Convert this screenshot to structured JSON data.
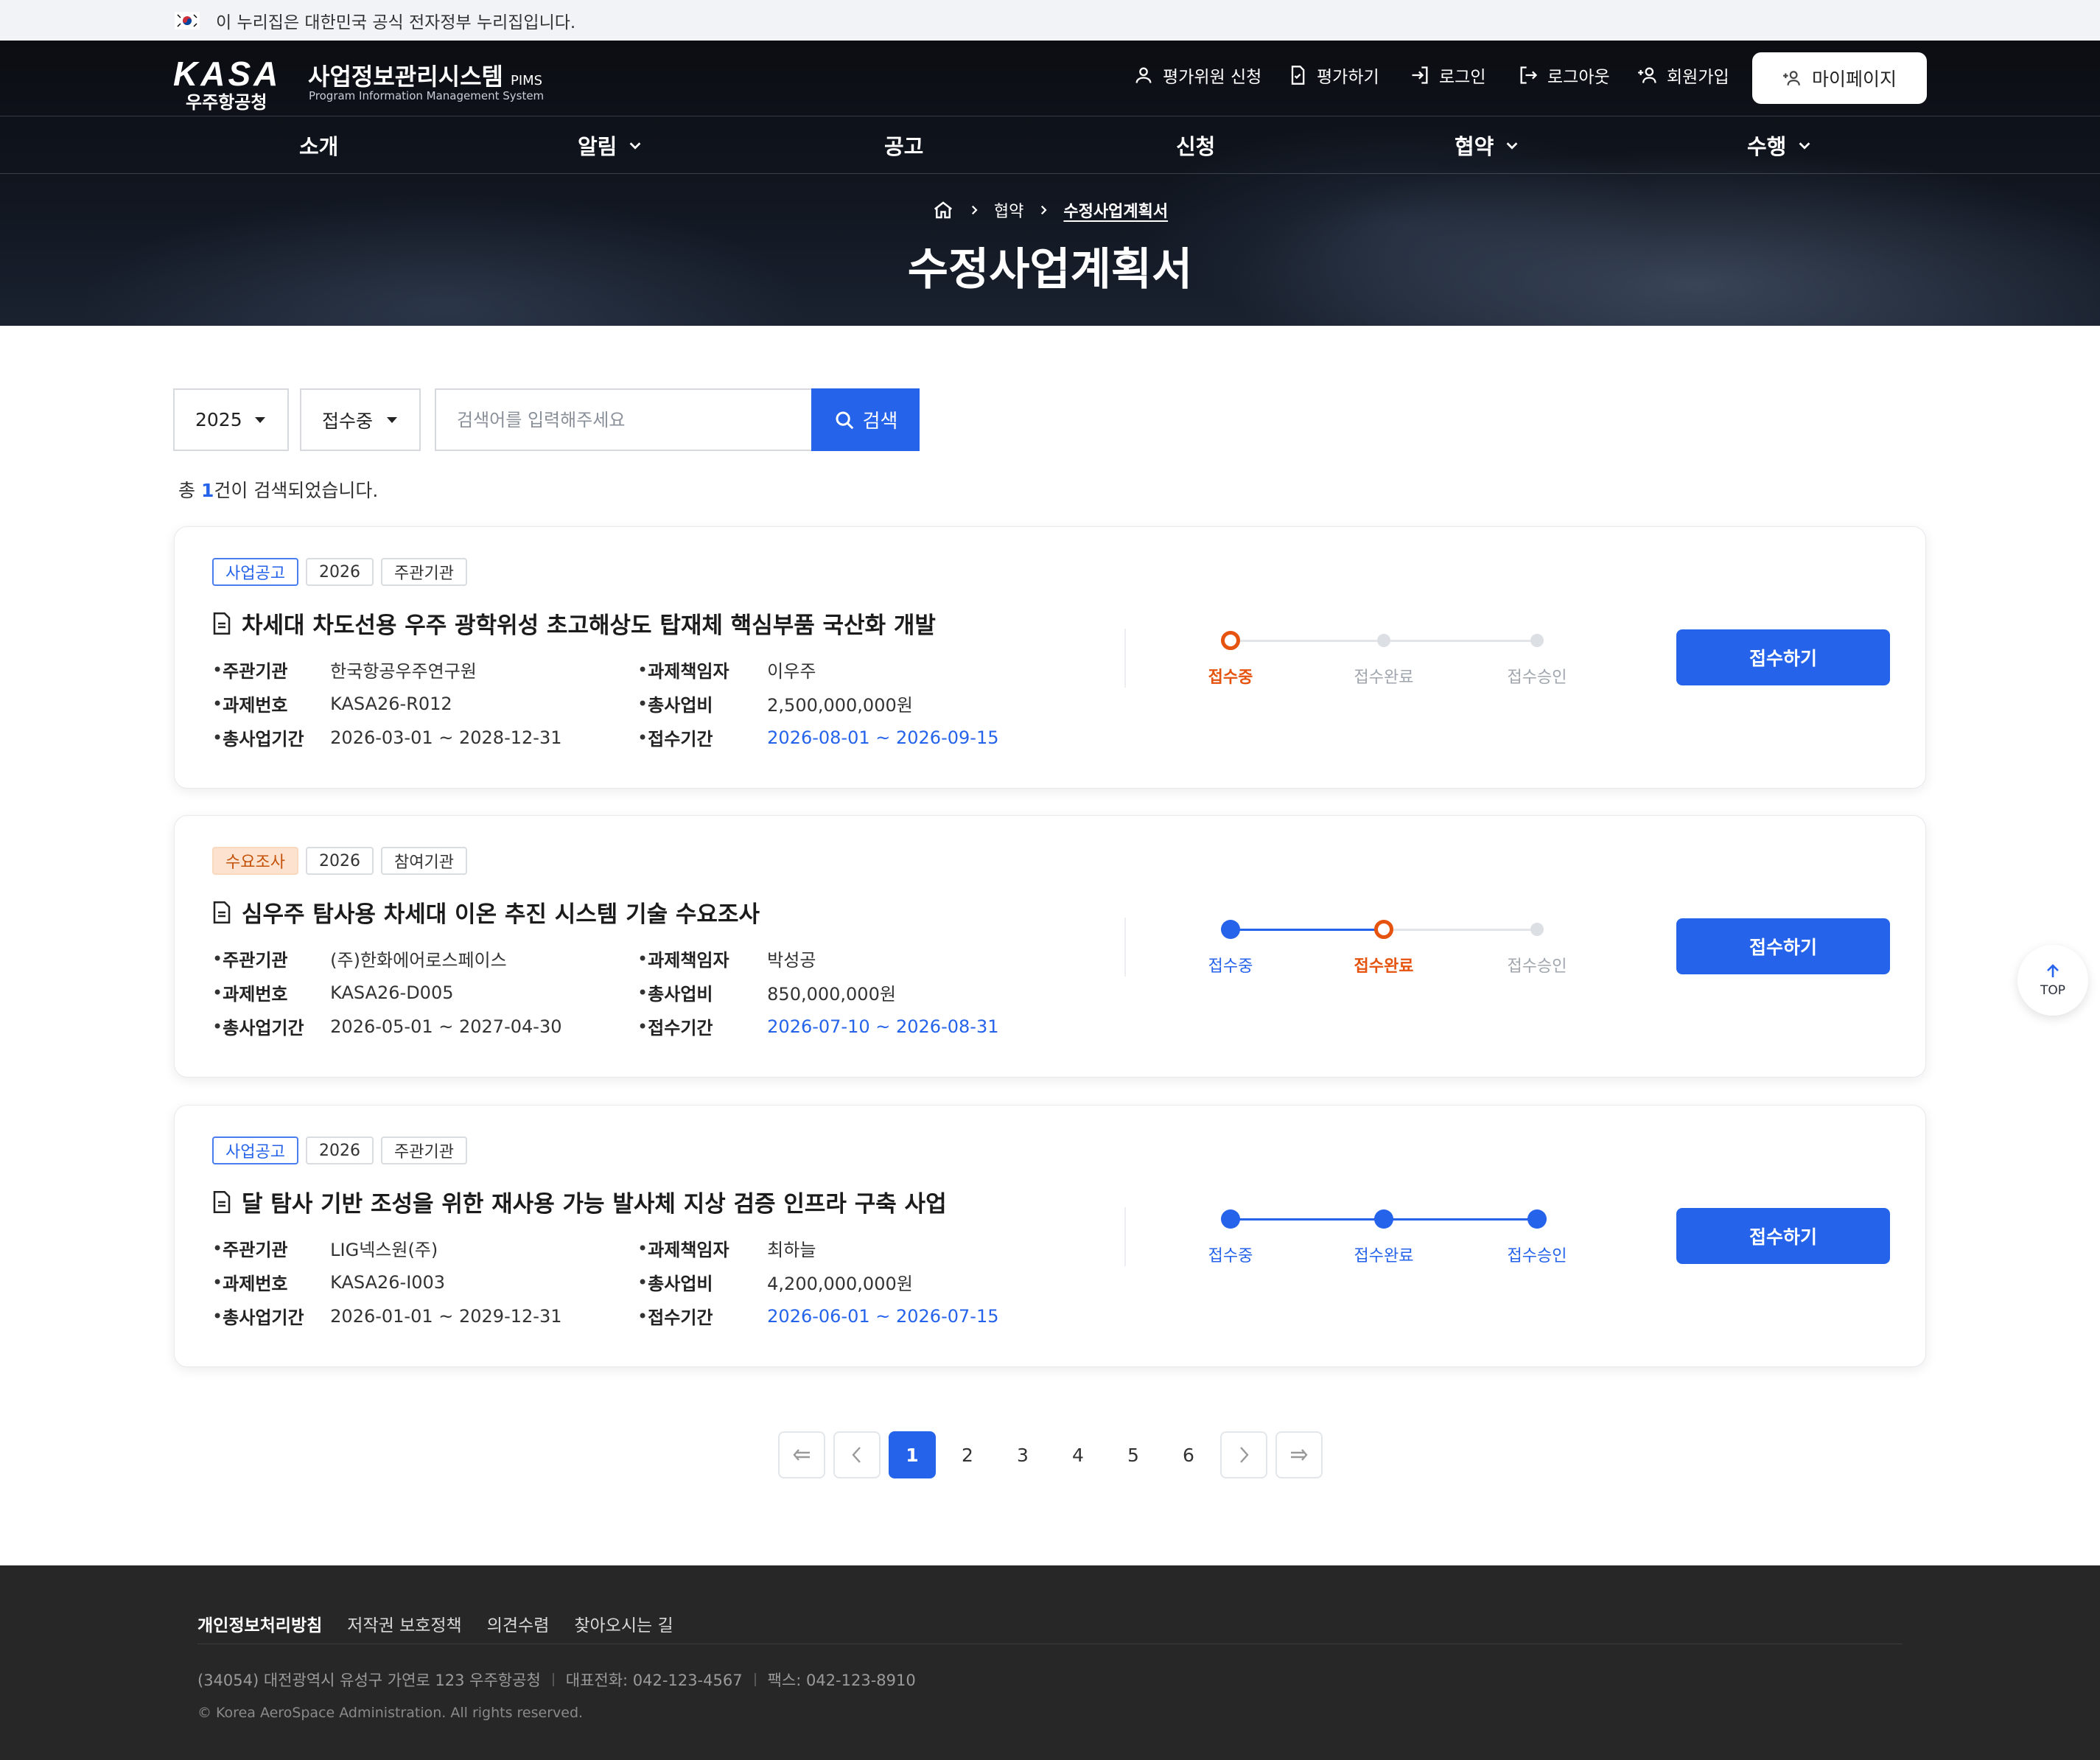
{
  "gov_banner": {
    "text": "이 누리집은 대한민국 공식 전자정부 누리집입니다."
  },
  "header": {
    "logo_text": "KASA",
    "logo_sub": "우주항공청",
    "system_title": "사업정보관리시스템",
    "system_abbr": "PIMS",
    "system_sub": "Program Information Management System",
    "util_links": [
      {
        "label": "평가위원 신청",
        "icon": "person-icon"
      },
      {
        "label": "평가하기",
        "icon": "document-check-icon"
      },
      {
        "label": "로그인",
        "icon": "login-icon"
      },
      {
        "label": "로그아웃",
        "icon": "logout-icon"
      },
      {
        "label": "회원가입",
        "icon": "person-add-icon"
      }
    ],
    "mypage_label": "마이페이지"
  },
  "nav": [
    {
      "label": "소개",
      "has_dropdown": false
    },
    {
      "label": "알림",
      "has_dropdown": true
    },
    {
      "label": "공고",
      "has_dropdown": false
    },
    {
      "label": "신청",
      "has_dropdown": false
    },
    {
      "label": "협약",
      "has_dropdown": true
    },
    {
      "label": "수행",
      "has_dropdown": true
    }
  ],
  "breadcrumb": [
    "협약",
    "수정사업계획서"
  ],
  "page_title": "수정사업계획서",
  "search": {
    "year_value": "2025",
    "status_value": "접수중",
    "placeholder": "검색어를 입력해주세요",
    "button_label": "검색"
  },
  "result": {
    "prefix": "총",
    "count": "1",
    "suffix": "건이 검색되었습니다."
  },
  "labels": {
    "org": "주관기관",
    "pm": "과제책임자",
    "task_no": "과제번호",
    "budget": "총사업비",
    "period": "총사업기간",
    "receipt_period": "접수기간",
    "steps": [
      "접수중",
      "접수완료",
      "접수승인"
    ],
    "apply": "접수하기"
  },
  "cards": [
    {
      "tags": [
        {
          "text": "사업공고",
          "style": "blue"
        },
        {
          "text": "2026",
          "style": "plain"
        },
        {
          "text": "주관기관",
          "style": "plain"
        }
      ],
      "title": "차세대 차도선용 우주 광학위성 초고해상도 탑재체 핵심부품 국산화 개발",
      "org": "한국항공우주연구원",
      "pm": "이우주",
      "task_no": "KASA26-R012",
      "budget": "2,500,000,000원",
      "period": "2026-03-01 ~ 2028-12-31",
      "receipt_period": "2026-08-01 ~ 2026-09-15",
      "current_step": 1
    },
    {
      "tags": [
        {
          "text": "수요조사",
          "style": "orange"
        },
        {
          "text": "2026",
          "style": "plain"
        },
        {
          "text": "참여기관",
          "style": "plain"
        }
      ],
      "title": "심우주 탐사용 차세대 이온 추진 시스템 기술 수요조사",
      "org": "(주)한화에어로스페이스",
      "pm": "박성공",
      "task_no": "KASA26-D005",
      "budget": "850,000,000원",
      "period": "2026-05-01 ~ 2027-04-30",
      "receipt_period": "2026-07-10 ~ 2026-08-31",
      "current_step": 2
    },
    {
      "tags": [
        {
          "text": "사업공고",
          "style": "blue"
        },
        {
          "text": "2026",
          "style": "plain"
        },
        {
          "text": "주관기관",
          "style": "plain"
        }
      ],
      "title": "달 탐사 기반 조성을 위한 재사용 가능 발사체 지상 검증 인프라 구축 사업",
      "org": "LIG넥스원(주)",
      "pm": "최하늘",
      "task_no": "KASA26-I003",
      "budget": "4,200,000,000원",
      "period": "2026-01-01 ~ 2029-12-31",
      "receipt_period": "2026-06-01 ~ 2026-07-15",
      "current_step": 3
    }
  ],
  "pagination": {
    "pages": [
      "1",
      "2",
      "3",
      "4",
      "5",
      "6"
    ],
    "current": "1"
  },
  "top_button": "TOP",
  "footer": {
    "links": [
      "개인정보처리방침",
      "저작권 보호정책",
      "의견수렴",
      "찾아오시는 길"
    ],
    "address": "(34054) 대전광역시 유성구 가연로 123 우주항공청",
    "tel": "대표전화: 042-123-4567",
    "fax": "팩스: 042-123-8910",
    "copyright": "© Korea AeroSpace Administration. All rights reserved."
  },
  "colors": {
    "primary": "#2563eb",
    "current_step": "#e5530e",
    "footer_bg": "#272727"
  }
}
